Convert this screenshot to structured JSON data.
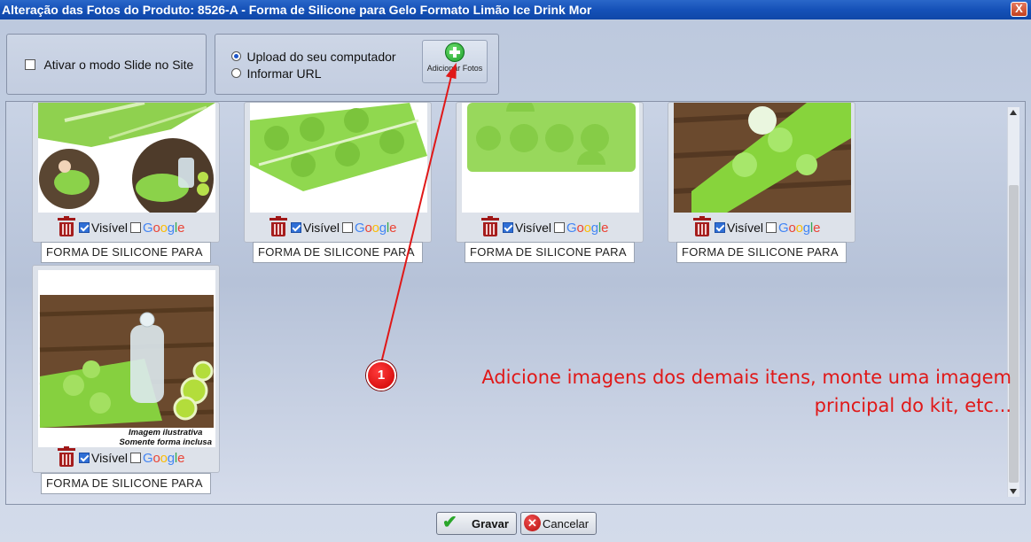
{
  "window": {
    "title": "Alteração das Fotos do Produto: 8526-A - Forma de Silicone para Gelo Formato Limão Ice Drink Mor",
    "close_label": "X"
  },
  "options": {
    "slide_mode_label": "Ativar o modo Slide no Site",
    "slide_mode_checked": false,
    "upload_computer_label": "Upload do seu computador",
    "inform_url_label": "Informar URL",
    "upload_selected": "computer",
    "add_photos_label": "Adicionar Fotos"
  },
  "photos": [
    {
      "caption": "FORMA DE SILICONE PARA",
      "visible_label": "Visível",
      "visible": true,
      "google": false
    },
    {
      "caption": "FORMA DE SILICONE PARA",
      "visible_label": "Visível",
      "visible": true,
      "google": false
    },
    {
      "caption": "FORMA DE SILICONE PARA",
      "visible_label": "Visível",
      "visible": true,
      "google": false
    },
    {
      "caption": "FORMA DE SILICONE PARA",
      "visible_label": "Visível",
      "visible": true,
      "google": false
    },
    {
      "caption": "FORMA DE SILICONE PARA",
      "visible_label": "Visível",
      "visible": true,
      "google": false,
      "image_note_line1": "Imagem ilustrativa",
      "image_note_line2": "Somente forma inclusa"
    }
  ],
  "google_label": "Google",
  "annotation": {
    "marker_number": "1",
    "text_line1": "Adicione imagens dos demais itens, monte uma imagem",
    "text_line2": "principal do kit, etc..."
  },
  "footer": {
    "save_label": "Gravar",
    "cancel_label": "Cancelar"
  }
}
